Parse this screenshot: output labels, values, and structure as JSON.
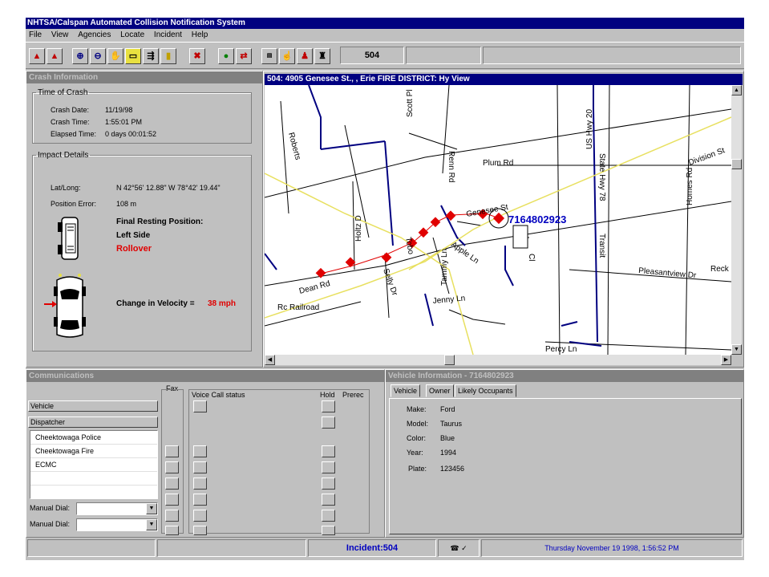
{
  "app": {
    "title": "NHTSA/Calspan Automated Collision Notification System"
  },
  "menu": [
    "File",
    "View",
    "Agencies",
    "Locate",
    "Incident",
    "Help"
  ],
  "toolbar": {
    "incident_field": "504",
    "icons": [
      "select-arrow-icon",
      "select-area-icon",
      "zoom-in-icon",
      "zoom-out-icon",
      "pan-hand-icon",
      "ruler-icon",
      "layer-icon",
      "label-icon",
      "clear-icon",
      "globe-icon",
      "route-icon",
      "map-overview-icon",
      "hand-icon",
      "person-icon",
      "agency-icon"
    ]
  },
  "crash": {
    "header": "Crash Information",
    "time_legend": "Time of Crash",
    "date_label": "Crash Date:",
    "date_value": "11/19/98",
    "time_label": "Crash Time:",
    "time_value": "1:55:01 PM",
    "elapsed_label": "Elapsed Time:",
    "elapsed_value": "0 days 00:01:52",
    "impact_legend": "Impact Details",
    "latlong_label": "Lat/Long:",
    "latlong_value": "N 42°56' 12.88\" W 78°42' 19.44\"",
    "position_label": "Position Error:",
    "position_value": "108 m",
    "resting_title": "Final Resting Position:",
    "resting_side": "Left Side",
    "rollover": "Rollover",
    "velocity_label": "Change in Velocity =",
    "velocity_value": "38 mph"
  },
  "map": {
    "header": "504: 4905 Genesee St., , Erie  FIRE DISTRICT: Hy View",
    "phone": "7164802923",
    "streets": [
      "Scott Pl",
      "US Hwy 20",
      "Plum Rd",
      "Division St",
      "Homes Rd",
      "Pleasantview Dr",
      "Reck",
      "Genesee St",
      "Dean Rd",
      "Rc Railroad",
      "Holtz D",
      "Renn Rd",
      "State Hwy 78",
      "Transit",
      "Tammy Ln",
      "Jenny Ln",
      "Roberts",
      "Tobo",
      "Apple Ln",
      "Selly Dr",
      "Percy Ln",
      "Cl"
    ]
  },
  "comms": {
    "header": "Communications",
    "fax_label": "Fax",
    "voice_label": "Voice Call status",
    "hold_label": "Hold",
    "prerec_label": "Prerec",
    "vehicle_label": "Vehicle",
    "dispatcher_label": "Dispatcher",
    "agencies": [
      "Cheektowaga Police",
      "Cheektowaga Fire",
      "ECMC"
    ],
    "manual_dial_label": "Manual Dial:"
  },
  "vehicle": {
    "header": "Vehicle Information - 7164802923",
    "tabs": [
      "Vehicle",
      "Owner",
      "Likely Occupants"
    ],
    "make_label": "Make:",
    "make_value": "Ford",
    "model_label": "Model:",
    "model_value": "Taurus",
    "color_label": "Color:",
    "color_value": "Blue",
    "year_label": "Year:",
    "year_value": "1994",
    "plate_label": "Plate:",
    "plate_value": "123456"
  },
  "statusbar": {
    "incident": "Incident:504",
    "datetime": "Thursday November 19 1998, 1:56:52 PM"
  },
  "colors": {
    "titlebar": "#000080",
    "marker": "#e00000",
    "road_major": "#000080",
    "road_yellow": "#e8e060"
  }
}
